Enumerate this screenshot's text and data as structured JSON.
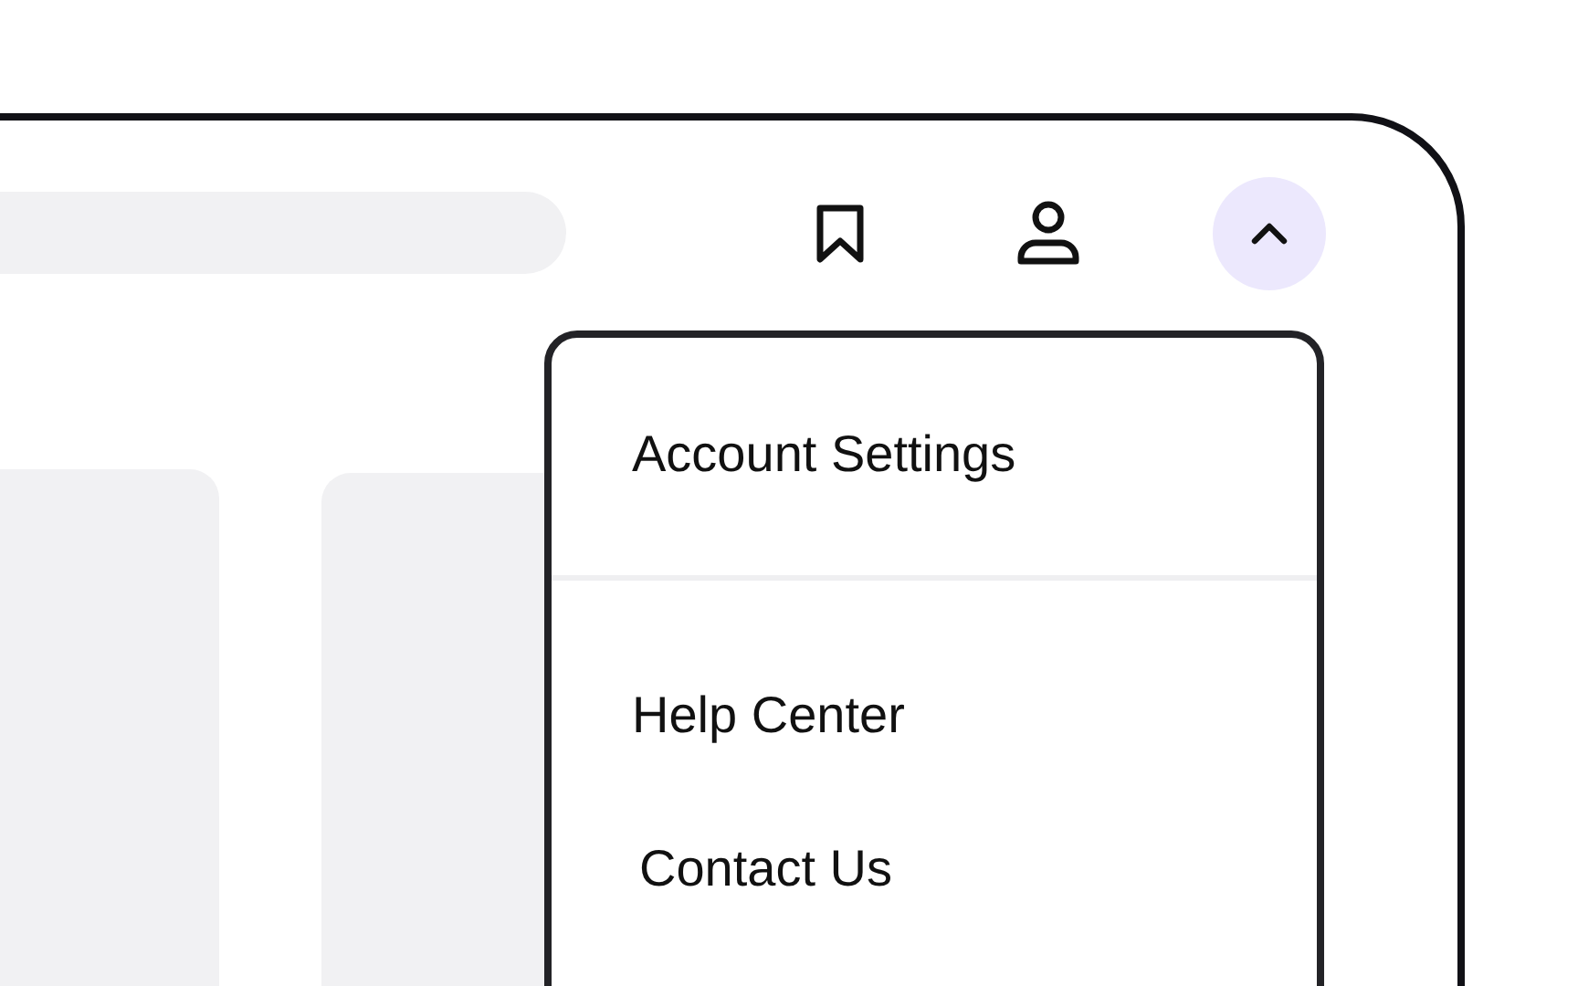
{
  "menu_button": {
    "expanded": true
  },
  "menu": {
    "groups": [
      {
        "items": [
          {
            "label": "Account Settings"
          }
        ]
      },
      {
        "items": [
          {
            "label": "Help Center"
          },
          {
            "label": "Contact Us"
          }
        ]
      }
    ]
  }
}
